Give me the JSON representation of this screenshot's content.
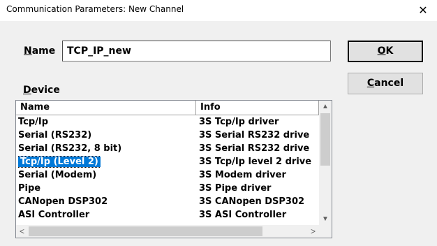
{
  "window": {
    "title": "Communication Parameters: New Channel",
    "close_glyph": "✕"
  },
  "name_field": {
    "label": "Name",
    "value": "TCP_IP_new"
  },
  "buttons": {
    "ok": "OK",
    "cancel": "Cancel"
  },
  "device": {
    "label": "Device",
    "columns": [
      "Name",
      "Info"
    ],
    "rows": [
      {
        "name": "Tcp/Ip",
        "info": "3S Tcp/Ip driver"
      },
      {
        "name": "Serial (RS232)",
        "info": "3S Serial RS232 drive"
      },
      {
        "name": "Serial (RS232, 8 bit)",
        "info": "3S Serial RS232 drive"
      },
      {
        "name": "Tcp/Ip (Level 2)",
        "info": "3S Tcp/Ip level 2 drive"
      },
      {
        "name": "Serial (Modem)",
        "info": "3S Modem driver"
      },
      {
        "name": "Pipe",
        "info": "3S Pipe driver"
      },
      {
        "name": "CANopen DSP302",
        "info": "3S CANopen DSP302"
      },
      {
        "name": "ASI Controller",
        "info": "3S ASI Controller"
      }
    ],
    "selected_index": 3
  },
  "scroll_glyphs": {
    "up": "▲",
    "down": "▼",
    "left": "<",
    "right": ">"
  }
}
